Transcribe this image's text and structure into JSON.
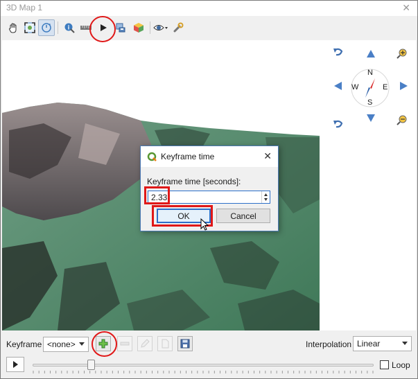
{
  "window": {
    "title": "3D Map 1",
    "close_glyph": "✕"
  },
  "toolbar": {
    "buttons": [
      {
        "name": "pan-tool",
        "icon": "hand-icon"
      },
      {
        "name": "zoom-full",
        "icon": "zoom-full-icon"
      },
      {
        "name": "camera-control",
        "icon": "camera-rotate-icon",
        "active": true
      },
      {
        "name": "identify",
        "icon": "identify-icon"
      },
      {
        "name": "measure",
        "icon": "measure-icon"
      },
      {
        "name": "animations",
        "icon": "play-icon",
        "highlighted": true
      },
      {
        "name": "save-as-image",
        "icon": "save-image-icon"
      },
      {
        "name": "export-3d-scene",
        "icon": "cube-icon"
      },
      {
        "name": "camera-options",
        "icon": "eye-icon"
      },
      {
        "name": "configure",
        "icon": "wrench-icon"
      }
    ]
  },
  "navigation": {
    "compass": {
      "n": "N",
      "s": "S",
      "e": "E",
      "w": "W"
    }
  },
  "dialog": {
    "title": "Keyframe time",
    "close_glyph": "✕",
    "label": "Keyframe time [seconds]:",
    "value": "2.33",
    "ok_label": "OK",
    "cancel_label": "Cancel"
  },
  "animation": {
    "keyframe_label": "Keyframe",
    "keyframe_value": "<none>",
    "interpolation_label": "Interpolation",
    "interpolation_value": "Linear",
    "loop_label": "Loop",
    "loop_checked": false,
    "slider_position": 0.17
  },
  "colors": {
    "highlight": "#e01818",
    "accent": "#2d6fc9",
    "terrain_green": "#5aa37a"
  }
}
